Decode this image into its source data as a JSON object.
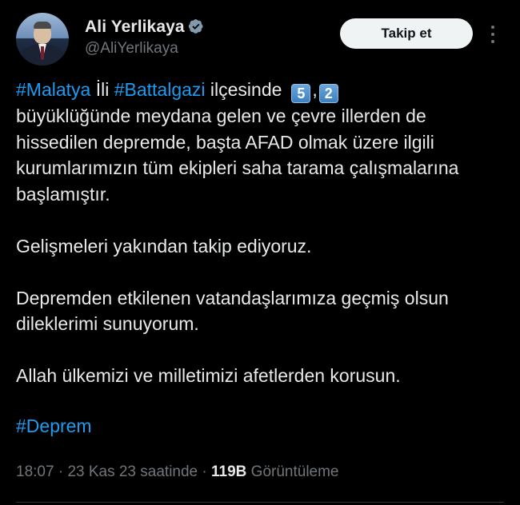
{
  "author": {
    "name": "Ali Yerlikaya",
    "handle": "@AliYerlikaya",
    "verified_icon": "verified-badge-icon"
  },
  "actions": {
    "follow_label": "Takip et",
    "more_icon": "more-options-icon"
  },
  "tweet": {
    "line1": {
      "hashtag1": "#Malatya",
      "text1": " İli ",
      "hashtag2": "#Battalgazi",
      "text2": " ilçesinde",
      "keycap1": "5",
      "sep": ",",
      "keycap2": "2"
    },
    "paragraph1_rest": "büyüklüğünde meydana gelen ve çevre illerden de hissedilen depremde, başta AFAD olmak üzere ilgili kurumlarımızın tüm ekipleri saha tarama çalışmalarına başlamıştır.",
    "paragraph2": "Gelişmeleri yakından takip ediyoruz.",
    "paragraph3": "Depremden etkilenen vatandaşlarımıza geçmiş olsun dileklerimi sunuyorum.",
    "paragraph4": "Allah ülkemizi ve milletimizi afetlerden korusun.",
    "hashtag_final": "#Deprem"
  },
  "meta": {
    "time": "18:07",
    "sep1": " · ",
    "date": "23 Kas 23 saatinde",
    "sep2": " · ",
    "views_count": "119B",
    "views_label": " Görüntüleme"
  },
  "colors": {
    "background": "#000000",
    "text": "#e7e9ea",
    "link": "#1d9bf0",
    "secondary": "#71767b",
    "verified_badge": "#829aab"
  }
}
